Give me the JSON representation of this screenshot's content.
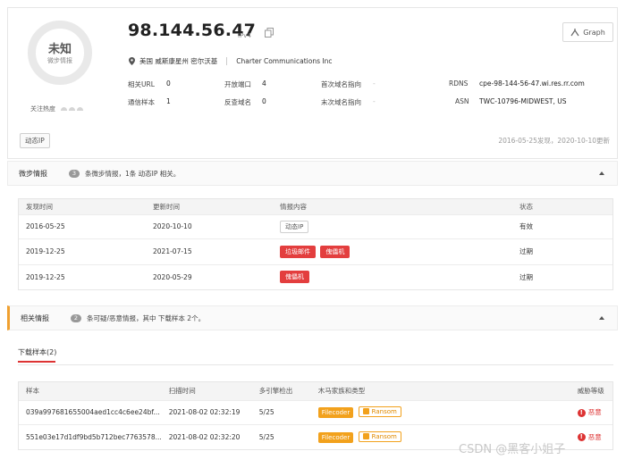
{
  "header": {
    "ip": "98.144.56.47",
    "ip_version": "IPv4",
    "graph_button": "Graph",
    "location": "美国 威斯康星州 密尔沃基",
    "isp": "Charter Communications Inc",
    "badge_main": "未知",
    "badge_sub": "微步情报",
    "heat_label": "关注热度",
    "dynamic_tag": "动态IP",
    "found_update": "2016-05-25发现，2020-10-10更新"
  },
  "stats": {
    "related_url_label": "相关URL",
    "related_url_value": "0",
    "open_ports_label": "开放端口",
    "open_ports_value": "4",
    "first_domain_label": "首次域名指向",
    "first_domain_value": "-",
    "rdns_label": "RDNS",
    "rdns_value": "cpe-98-144-56-47.wi.res.rr.com",
    "comm_samples_label": "通信样本",
    "comm_samples_value": "1",
    "reverse_domain_label": "反查域名",
    "reverse_domain_value": "0",
    "last_domain_label": "末次域名指向",
    "last_domain_value": "-",
    "asn_label": "ASN",
    "asn_value": "TWC-10796-MIDWEST, US"
  },
  "intel_section": {
    "title": "微步情报",
    "count": "3",
    "desc": "条微步情报，1条 动态IP 相关。",
    "columns": [
      "发现时间",
      "更新时间",
      "情报内容",
      "状态"
    ],
    "rows": [
      {
        "found": "2016-05-25",
        "updated": "2020-10-10",
        "tags": [
          {
            "text": "动态IP",
            "kind": "white"
          }
        ],
        "status": "有效",
        "status_kind": "valid"
      },
      {
        "found": "2019-12-25",
        "updated": "2021-07-15",
        "tags": [
          {
            "text": "垃圾邮件",
            "kind": "red"
          },
          {
            "text": "傀儡机",
            "kind": "red"
          }
        ],
        "status": "过期",
        "status_kind": "expired"
      },
      {
        "found": "2019-12-25",
        "updated": "2020-05-29",
        "tags": [
          {
            "text": "傀儡机",
            "kind": "red"
          }
        ],
        "status": "过期",
        "status_kind": "expired"
      }
    ]
  },
  "related_section": {
    "title": "相关情报",
    "count": "2",
    "desc": "条可疑/恶意情报，其中 下载样本 2个。",
    "tab_label": "下载样本(2)",
    "columns": [
      "样本",
      "扫描时间",
      "多引擎检出",
      "木马家族和类型",
      "威胁等级"
    ],
    "rows": [
      {
        "hash": "039a997681655004aed1cc4c6ee24bf...",
        "scan_time": "2021-08-02 02:32:19",
        "detect": "5/25",
        "family": "Filecoder",
        "type": "Ransom",
        "threat": "恶意"
      },
      {
        "hash": "551e03e17d1df9bd5b712bec7763578...",
        "scan_time": "2021-08-02 02:32:20",
        "detect": "5/25",
        "family": "Filecoder",
        "type": "Ransom",
        "threat": "恶意"
      }
    ]
  },
  "watermark": "CSDN @黑客小姐子",
  "colors": {
    "danger": "#e33e3e",
    "orange": "#f2a11c",
    "valid": "#3aa757"
  }
}
